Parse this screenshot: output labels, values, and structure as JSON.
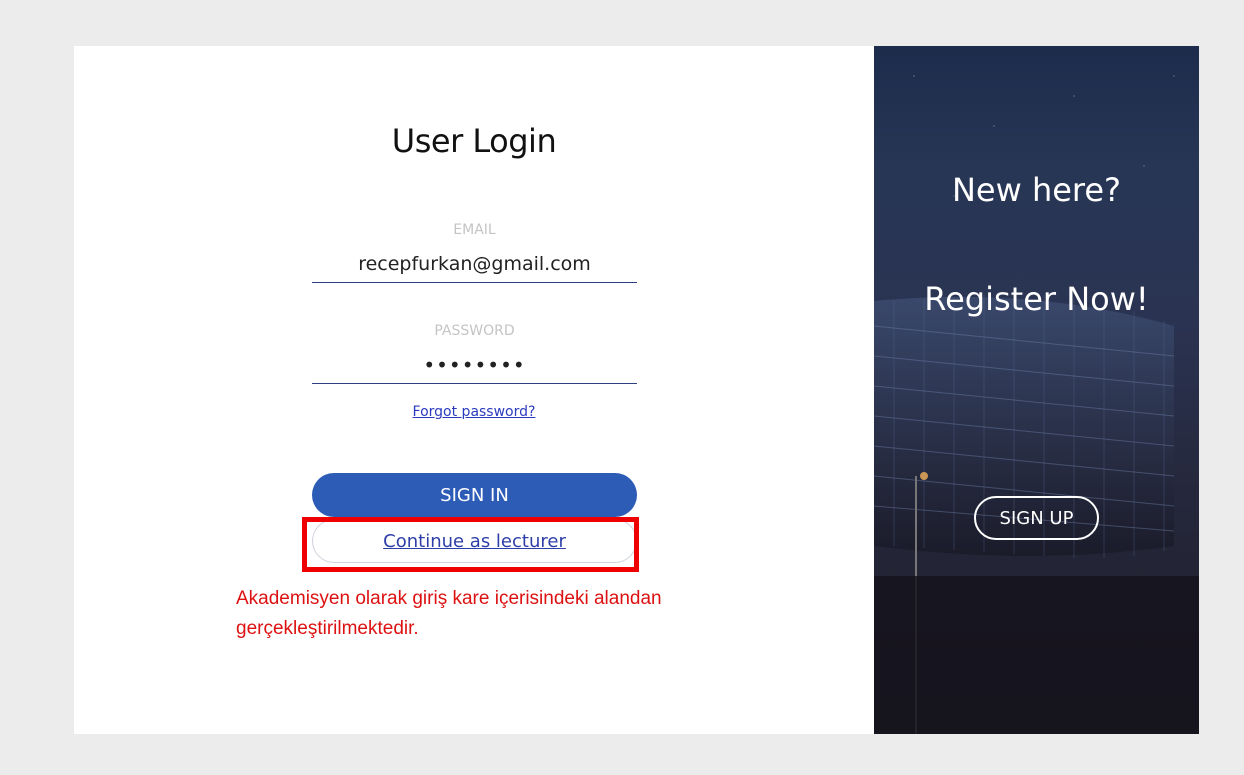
{
  "login": {
    "title": "User Login",
    "email_label": "EMAIL",
    "email_value": "recepfurkan@gmail.com",
    "password_label": "PASSWORD",
    "password_value": "••••••••",
    "forgot_password": "Forgot password?",
    "sign_in_label": "SIGN IN",
    "lecturer_label": "Continue as lecturer"
  },
  "annotation": {
    "line1": "Akademisyen olarak giriş kare içerisindeki alandan",
    "line2": "gerçekleştirilmektedir."
  },
  "side": {
    "heading": "New here?",
    "subheading": "Register Now!",
    "sign_up_label": "SIGN UP"
  },
  "colors": {
    "page_bg": "#ececec",
    "primary_button": "#2d5cb7",
    "link": "#2b3bbf",
    "annotation": "#ee0000"
  }
}
